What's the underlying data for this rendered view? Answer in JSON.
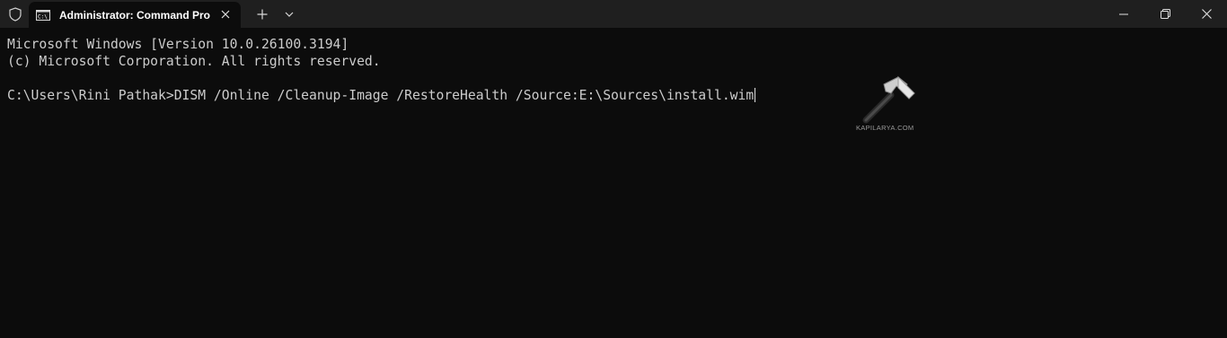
{
  "titlebar": {
    "tab_title": "Administrator: Command Pro",
    "tab_icon": "cmd-icon",
    "shield_icon": "shield-icon",
    "new_tab_icon": "plus-icon",
    "dropdown_icon": "chevron-down-icon",
    "window_controls": [
      "minimize-icon",
      "restore-icon",
      "close-icon"
    ]
  },
  "terminal": {
    "lines": [
      "Microsoft Windows [Version 10.0.26100.3194]",
      "(c) Microsoft Corporation. All rights reserved.",
      "",
      "C:\\Users\\Rini Pathak>DISM /Online /Cleanup-Image /RestoreHealth /Source:E:\\Sources\\install.wim"
    ],
    "text_color": "#cccccc",
    "background": "#0c0c0c"
  },
  "watermark": {
    "text": "KAPILARYA.COM",
    "icon": "hammer-logo"
  }
}
